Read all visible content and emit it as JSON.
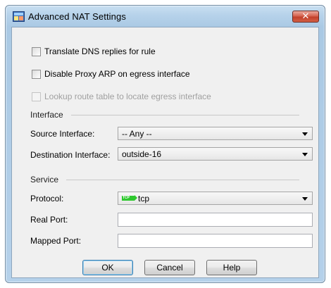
{
  "window": {
    "title": "Advanced NAT Settings",
    "close_glyph": "✕",
    "icon": "asdm-app-icon"
  },
  "options": {
    "translate_dns": {
      "label": "Translate DNS replies for rule",
      "checked": false,
      "enabled": true
    },
    "disable_proxy_arp": {
      "label": "Disable Proxy ARP on egress interface",
      "checked": false,
      "enabled": true
    },
    "lookup_route": {
      "label": "Lookup route table to locate egress interface",
      "checked": false,
      "enabled": false
    }
  },
  "interface": {
    "group_title": "Interface",
    "source_label": "Source Interface:",
    "source_value": "-- Any --",
    "destination_label": "Destination Interface:",
    "destination_value": "outside-16"
  },
  "service": {
    "group_title": "Service",
    "protocol_label": "Protocol:",
    "protocol_icon_text": "TCP",
    "protocol_value": "tcp",
    "real_port_label": "Real Port:",
    "real_port_value": "",
    "mapped_port_label": "Mapped Port:",
    "mapped_port_value": ""
  },
  "buttons": {
    "ok": "OK",
    "cancel": "Cancel",
    "help": "Help"
  },
  "colors": {
    "title_gradient": "#b6d2ea",
    "close_red": "#c2402a",
    "tcp_green": "#2ec82e",
    "client_bg": "#f0f0f0"
  }
}
